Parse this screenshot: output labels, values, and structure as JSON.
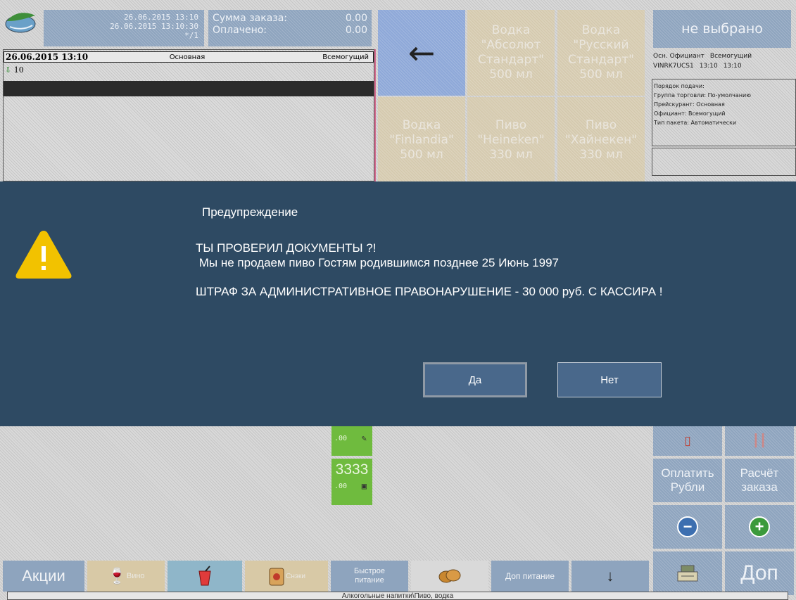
{
  "header": {
    "date_open": "26.06.2015 13:10",
    "date_now": "26.06.2015 13:10:30",
    "table": "*/1",
    "sum_label": "Сумма заказа:",
    "sum_value": "0.00",
    "paid_label": "Оплачено:",
    "paid_value": "0.00"
  },
  "order": {
    "date": "26.06.2015 13:10",
    "menu": "Основная",
    "waiter": "Всемогущий",
    "line": "10"
  },
  "tiles": [
    {
      "label": "Водка \"Абсолют Стандарт\" 500 мл"
    },
    {
      "label": "Водка \"Русский Стандарт\" 500 мл"
    },
    {
      "label": "Водка \"Finlandia\" 500 мл"
    },
    {
      "label": "Пиво \"Heineken\" 330 мл"
    },
    {
      "label": "Пиво \"Хайнекен\" 330 мл"
    }
  ],
  "right_panel": {
    "not_selected": "не выбрано",
    "info1_label": "Осн. Официант",
    "info1_value": "Всемогущий",
    "station": "VINRK7UCS1",
    "time1": "13:10",
    "time2": "13:10",
    "info2": [
      "Порядок подачи:",
      "Группа торговли: По-умолчанию",
      "Прейскурант: Основная",
      "Официант: Всемогущий",
      "Тип пакета: Автоматически"
    ]
  },
  "modal": {
    "title": "Предупреждение",
    "line1": "ТЫ ПРОВЕРИЛ ДОКУМЕНТЫ ?!",
    "line2": " Мы не продаем пиво Гостям родившимся позднее 25 Июнь 1997",
    "line3": "ШТРАФ ЗА АДМИНИСТРАТИВНОЕ ПРАВОНАРУШЕНИЕ - 30 000 руб. С КАССИРА !",
    "yes_label": "Да",
    "no_label": "Нет"
  },
  "green_tiles": {
    "t1_small": ".00",
    "t2_code": "3333",
    "t2_small": ".00"
  },
  "right_buttons": {
    "pay_line1": "Оплатить",
    "pay_line2": "Рубли",
    "calc_line1": "Расчёт",
    "calc_line2": "заказа",
    "dop": "Доп"
  },
  "categories": {
    "actions": "Акции",
    "wine": "Вино",
    "snack": "Снэки",
    "fast_line1": "Быстрое",
    "fast_line2": "питание",
    "dop_food": "Доп питание"
  },
  "status": "Алкогольные напитки\\Пиво, водка",
  "colors": {
    "modal_bg": "#2e4a63",
    "tile_blue": "#8ea4be",
    "tile_tan": "#d8c9a6",
    "tile_green": "#6fbb3e",
    "warning": "#f2c200"
  }
}
